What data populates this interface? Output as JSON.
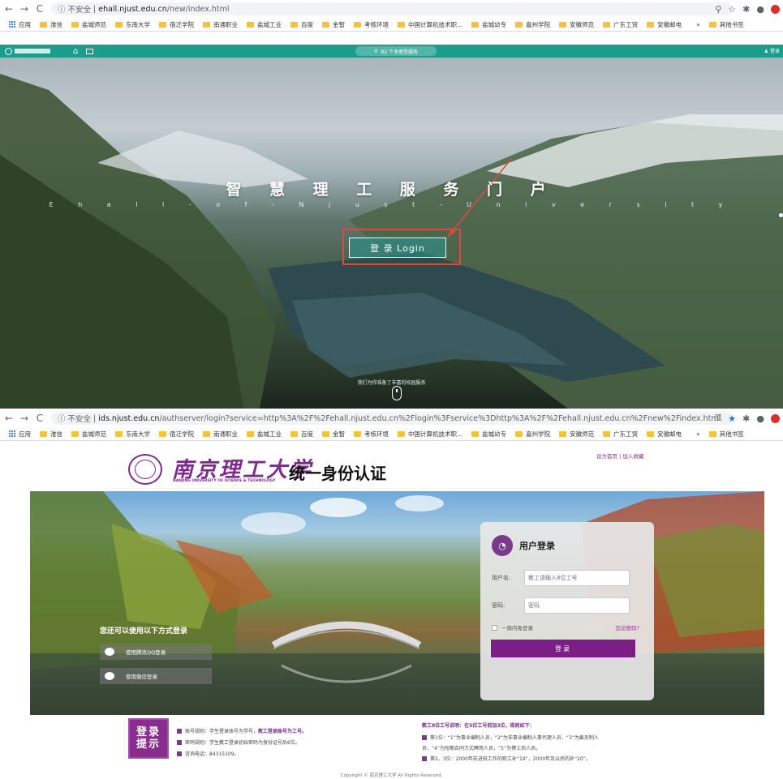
{
  "browser_top": {
    "back": "←",
    "forward": "→",
    "reload": "C",
    "security": "ⓘ 不安全",
    "host": "ehall.njust.edu.cn",
    "path": "/new/index.html",
    "bookmarks": [
      "应用",
      "淮信",
      "盐城师范",
      "东南大学",
      "宿迁学院",
      "南通职业",
      "盐城工业",
      "百度",
      "金智",
      "考核环境",
      "中国计算机技术职...",
      "盐城幼专",
      "嘉州学院",
      "安徽师范",
      "广东工贸",
      "安徽邮电"
    ],
    "other_bookmarks": "其他书签",
    "more": "»"
  },
  "portal": {
    "search": "82 个多类型服务",
    "login_corner": "登录",
    "title": "智 慧 理 工 服 务 门 户",
    "subtitle": "E h a l l - o f - N j u s t - U n i v e r s i t y",
    "login_button": "登 录  Login",
    "footer_text": "我们为你准备了丰富的校园服务"
  },
  "browser_bottom": {
    "back": "←",
    "forward": "→",
    "reload": "C",
    "security": "ⓘ 不安全",
    "host": "ids.njust.edu.cn",
    "path": "/authserver/login?service=http%3A%2F%2Fehall.njust.edu.cn%2Flogin%3Fservice%3Dhttp%3A%2F%2Fehall.njust.edu.cn%2Fnew%2Findex.html",
    "bookmarks": [
      "应用",
      "淮信",
      "盐城师范",
      "东南大学",
      "宿迁学院",
      "南通职业",
      "盐城工业",
      "百度",
      "金智",
      "考核环境",
      "中国计算机技术职...",
      "盐城幼专",
      "嘉州学院",
      "安徽师范",
      "广东工贸",
      "安徽邮电"
    ],
    "other_bookmarks": "其他书签",
    "more": "»"
  },
  "ids": {
    "university_cn": "南京理工大学",
    "university_en": "NANJING UNIVERSITY OF SCIENCE & TECHNOLOGY",
    "system_title": "统一身份认证",
    "home_links": "设为首页 | 加入收藏",
    "alt_login_title": "您还可以使用以下方式登录",
    "qq_login": "使用腾讯QQ登录",
    "wechat_login": "使用微信登录",
    "panel_title": "用户登录",
    "username_label": "用户名:",
    "username_placeholder": "教工请输入8位工号",
    "password_label": "密码:",
    "password_placeholder": "密码",
    "remember": "一周内免登录",
    "forgot": "忘记密码?",
    "submit": "登录",
    "stamp_line1": "登录",
    "stamp_line2": "提示",
    "note1_a": "账号规则：学生登录账号为学号，",
    "note1_b": "教工登录账号为工号。",
    "note2": "密码规则：学生教工登录初始密码为身份证号后6位。",
    "note3": "咨询电话：84315109。",
    "staff_title": "教工8位工号说明：在5位工号前加3位，规则如下：",
    "staff1": "第1位：“1”为事业编制人员，“2”为非事业编制人事代理人员，“3”为雇员制人",
    "staff1b": "员，“4”为短期合同方式聘用人员，“5”为博士后人员。",
    "staff2": "第2、3位：2000年前进校工作的职工补“19”，2000年及以后的补“20”。",
    "copyright": "Copyright © 南京理工大学 All Rights Reserved."
  },
  "colors": {
    "portal_bar": "#1a9d8c",
    "accent": "#7b1f86",
    "highlight_box": "#e0483e"
  }
}
